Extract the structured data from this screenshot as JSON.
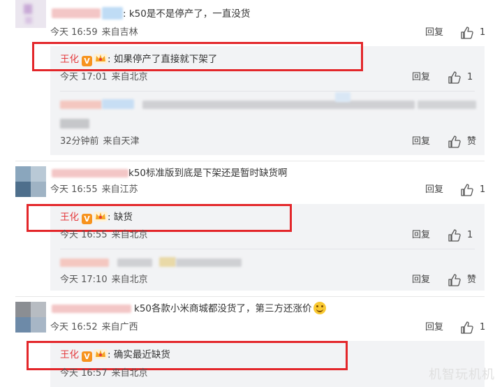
{
  "comments": [
    {
      "text": "k50是不是停产了，一直没货",
      "time": "今天 16:59",
      "location": "来自吉林",
      "reply_label": "回复",
      "likes": "1",
      "replies": [
        {
          "author": "王化",
          "text": ":  如果停产了直接就下架了",
          "time": "今天 17:01",
          "location": "来自北京",
          "reply_label": "回复",
          "likes": "1"
        },
        {
          "author": "",
          "text": "",
          "time": "32分钟前",
          "location": "来自天津",
          "reply_label": "回复",
          "likes": "赞"
        }
      ]
    },
    {
      "text": "k50标准版到底是下架还是暂时缺货啊",
      "time": "今天 16:55",
      "location": "来自江苏",
      "reply_label": "回复",
      "likes": "1",
      "replies": [
        {
          "author": "王化",
          "text": ":  缺货",
          "time": "今天 16:55",
          "location": "来自北京",
          "reply_label": "回复",
          "likes": "1"
        },
        {
          "author": "",
          "text": "",
          "time": "今天 17:10",
          "location": "来自北京",
          "reply_label": "回复",
          "likes": "赞"
        }
      ]
    },
    {
      "text": "k50各款小米商城都没货了，第三方还涨价",
      "time": "今天 16:52",
      "location": "来自广西",
      "reply_label": "回复",
      "likes": "1",
      "replies": [
        {
          "author": "王化",
          "text": ":  确实最近缺货",
          "time": "今天 16:57",
          "location": "来自北京"
        }
      ]
    }
  ],
  "badge_letter": "V",
  "watermark": "机智玩机机",
  "colors": {
    "highlight_box": "#e3262a",
    "author_name": "#e4393c",
    "panel_bg": "#f2f3f5"
  }
}
